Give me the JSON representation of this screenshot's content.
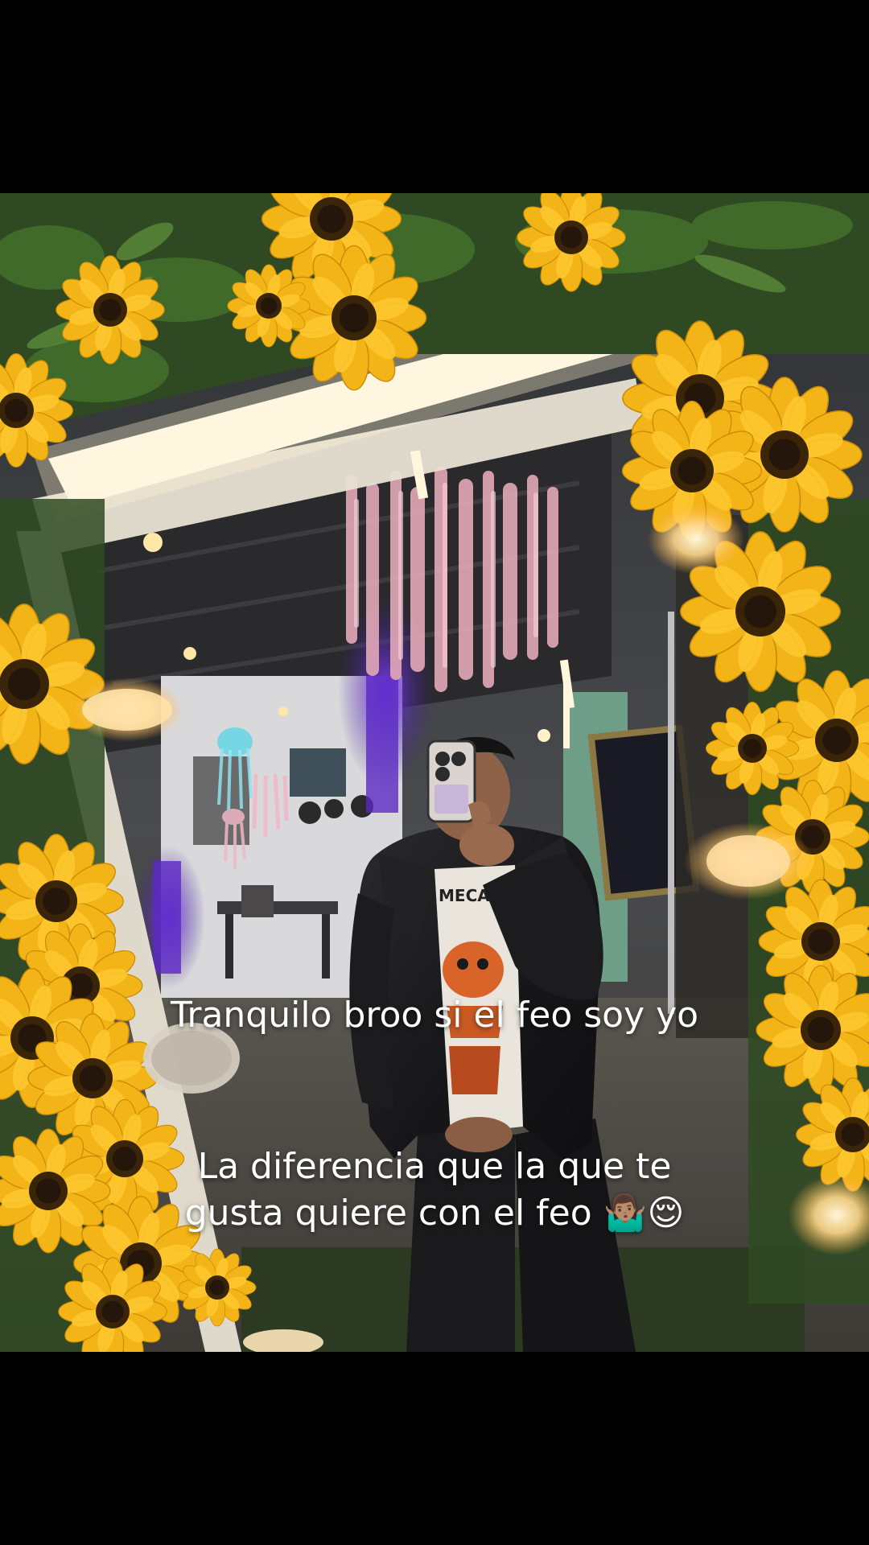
{
  "caption": {
    "line1": "Tranquilo broo si el feo soy yo",
    "line2": "La diferencia que la que te gusta quiere con el feo 🤷🏽‍♂️😌"
  },
  "colors": {
    "background": "#000000",
    "caption_text": "#ffffff",
    "sunflower_petal": "#f2b417",
    "sunflower_center": "#3a2508",
    "foliage": "#2f4a22",
    "led_strip": "#fff8e6",
    "wisteria": "#e3a9b8",
    "purple_light": "#6a2fd6"
  },
  "scene": {
    "description_icon": "mirror-selfie-photo"
  }
}
